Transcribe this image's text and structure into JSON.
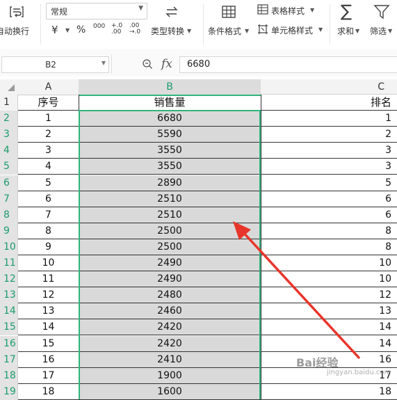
{
  "ribbon": {
    "wrap_text": "自动换行",
    "number_format": "常规",
    "currency_symbol": "¥",
    "percent_symbol": "%",
    "thousands_symbol": "000",
    "increase_decimal": "+.0 .00",
    "decrease_decimal": ".00 →.0",
    "type_convert": "类型转换",
    "conditional_format": "条件格式",
    "table_style": "表格样式",
    "cell_style": "单元格样式",
    "sum": "求和",
    "filter": "筛选"
  },
  "formula_bar": {
    "name_box": "B2",
    "fx_label": "fx",
    "formula_value": "6680"
  },
  "sheet": {
    "columns": [
      "A",
      "B",
      "C"
    ],
    "header_row": {
      "row_num": "1",
      "a": "序号",
      "b": "销售量",
      "c": "排名"
    },
    "rows": [
      {
        "n": "2",
        "a": "1",
        "b": "6680",
        "c": "1"
      },
      {
        "n": "3",
        "a": "2",
        "b": "5590",
        "c": "2"
      },
      {
        "n": "4",
        "a": "3",
        "b": "3550",
        "c": "3"
      },
      {
        "n": "5",
        "a": "4",
        "b": "3550",
        "c": "3"
      },
      {
        "n": "6",
        "a": "5",
        "b": "2890",
        "c": "5"
      },
      {
        "n": "7",
        "a": "6",
        "b": "2510",
        "c": "6"
      },
      {
        "n": "8",
        "a": "7",
        "b": "2510",
        "c": "6"
      },
      {
        "n": "9",
        "a": "8",
        "b": "2500",
        "c": "8"
      },
      {
        "n": "10",
        "a": "9",
        "b": "2500",
        "c": "8"
      },
      {
        "n": "11",
        "a": "10",
        "b": "2490",
        "c": "10"
      },
      {
        "n": "12",
        "a": "11",
        "b": "2490",
        "c": "10"
      },
      {
        "n": "13",
        "a": "12",
        "b": "2480",
        "c": "12"
      },
      {
        "n": "14",
        "a": "13",
        "b": "2460",
        "c": "13"
      },
      {
        "n": "15",
        "a": "14",
        "b": "2420",
        "c": "14"
      },
      {
        "n": "16",
        "a": "15",
        "b": "2420",
        "c": "14"
      },
      {
        "n": "17",
        "a": "16",
        "b": "2410",
        "c": "16"
      },
      {
        "n": "18",
        "a": "17",
        "b": "1900",
        "c": "17"
      },
      {
        "n": "19",
        "a": "18",
        "b": "1600",
        "c": "18"
      }
    ]
  },
  "colors": {
    "selection_border": "#2fb57c",
    "selected_fill": "#d9d9d9",
    "arrow": "#e8352b"
  },
  "watermark": {
    "text": "Bai经验",
    "sub": "jingyan.baidu.com"
  }
}
